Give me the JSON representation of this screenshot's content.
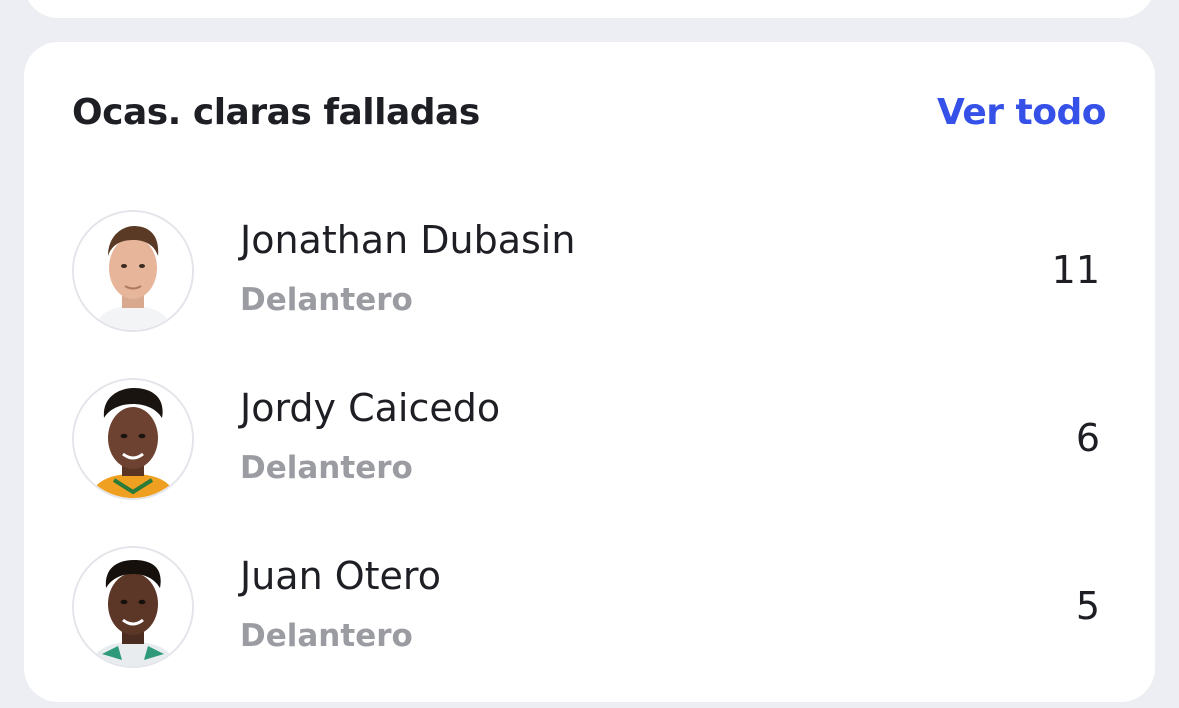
{
  "card": {
    "title": "Ocas. claras falladas",
    "see_all_label": "Ver todo"
  },
  "players": [
    {
      "name": "Jonathan Dubasin",
      "position": "Delantero",
      "value": "11",
      "avatar_icon": "player-photo"
    },
    {
      "name": "Jordy Caicedo",
      "position": "Delantero",
      "value": "6",
      "avatar_icon": "player-photo"
    },
    {
      "name": "Juan Otero",
      "position": "Delantero",
      "value": "5",
      "avatar_icon": "player-photo"
    }
  ],
  "colors": {
    "accent": "#3551e8",
    "background": "#eceef3",
    "card": "#ffffff",
    "text_primary": "#1e1f24",
    "text_secondary": "#9a9ca2"
  }
}
